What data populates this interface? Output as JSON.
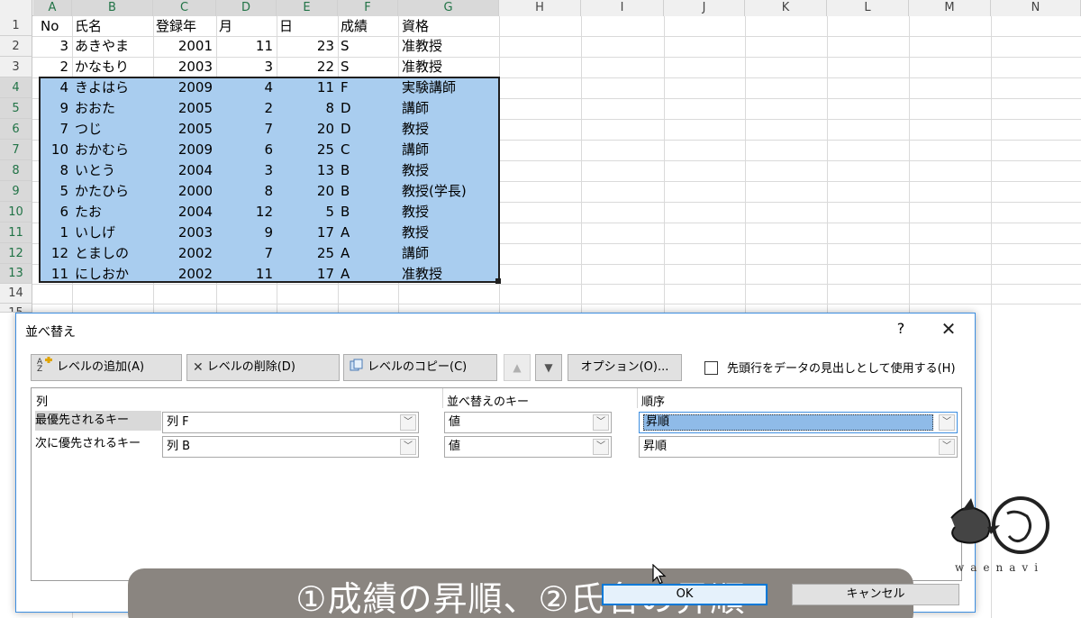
{
  "sheet": {
    "columns": [
      "A",
      "B",
      "C",
      "D",
      "E",
      "F",
      "G",
      "H",
      "I",
      "J",
      "K",
      "L",
      "M",
      "N"
    ],
    "rows": [
      "1",
      "2",
      "3",
      "4",
      "5",
      "6",
      "7",
      "8",
      "9",
      "10",
      "11",
      "12",
      "13",
      "14",
      "15"
    ],
    "header": [
      "No",
      "氏名",
      "登録年",
      "月",
      "日",
      "成績",
      "資格"
    ],
    "data": [
      [
        "3",
        "あきやま",
        "2001",
        "11",
        "23",
        "S",
        "准教授"
      ],
      [
        "2",
        "かなもり",
        "2003",
        "3",
        "22",
        "S",
        "准教授"
      ],
      [
        "4",
        "きよはら",
        "2009",
        "4",
        "11",
        "F",
        "実験講師"
      ],
      [
        "9",
        "おおた",
        "2005",
        "2",
        "8",
        "D",
        "講師"
      ],
      [
        "7",
        "つじ",
        "2005",
        "7",
        "20",
        "D",
        "教授"
      ],
      [
        "10",
        "おかむら",
        "2009",
        "6",
        "25",
        "C",
        "講師"
      ],
      [
        "8",
        "いとう",
        "2004",
        "3",
        "13",
        "B",
        "教授"
      ],
      [
        "5",
        "かたひら",
        "2000",
        "8",
        "20",
        "B",
        "教授(学長)"
      ],
      [
        "6",
        "たお",
        "2004",
        "12",
        "5",
        "B",
        "教授"
      ],
      [
        "1",
        "いしげ",
        "2003",
        "9",
        "17",
        "A",
        "教授"
      ],
      [
        "12",
        "とましの",
        "2002",
        "7",
        "25",
        "A",
        "講師"
      ],
      [
        "11",
        "にしおか",
        "2002",
        "11",
        "17",
        "A",
        "准教授"
      ]
    ],
    "selection_color": "#a9cdef"
  },
  "dialog": {
    "title": "並べ替え",
    "help": "?",
    "close": "✕",
    "toolbar": {
      "add_level": "レベルの追加(A)",
      "delete_level": "レベルの削除(D)",
      "copy_level": "レベルのコピー(C)",
      "move_up": "▲",
      "move_down": "▼",
      "options": "オプション(O)...",
      "header_checkbox_label": "先頭行をデータの見出しとして使用する(H)"
    },
    "grid": {
      "col_header": "列",
      "key_header": "並べ替えのキー",
      "order_header": "順序",
      "levels": [
        {
          "label": "最優先されるキー",
          "column": "列 F",
          "key": "値",
          "order": "昇順"
        },
        {
          "label": "次に優先されるキー",
          "column": "列 B",
          "key": "値",
          "order": "昇順"
        }
      ]
    },
    "ok": "OK",
    "cancel": "キャンセル"
  },
  "caption": "①成績の昇順、②氏名の昇順",
  "watermark": {
    "text": "waenavi",
    "icon": "bird-logo-icon"
  }
}
